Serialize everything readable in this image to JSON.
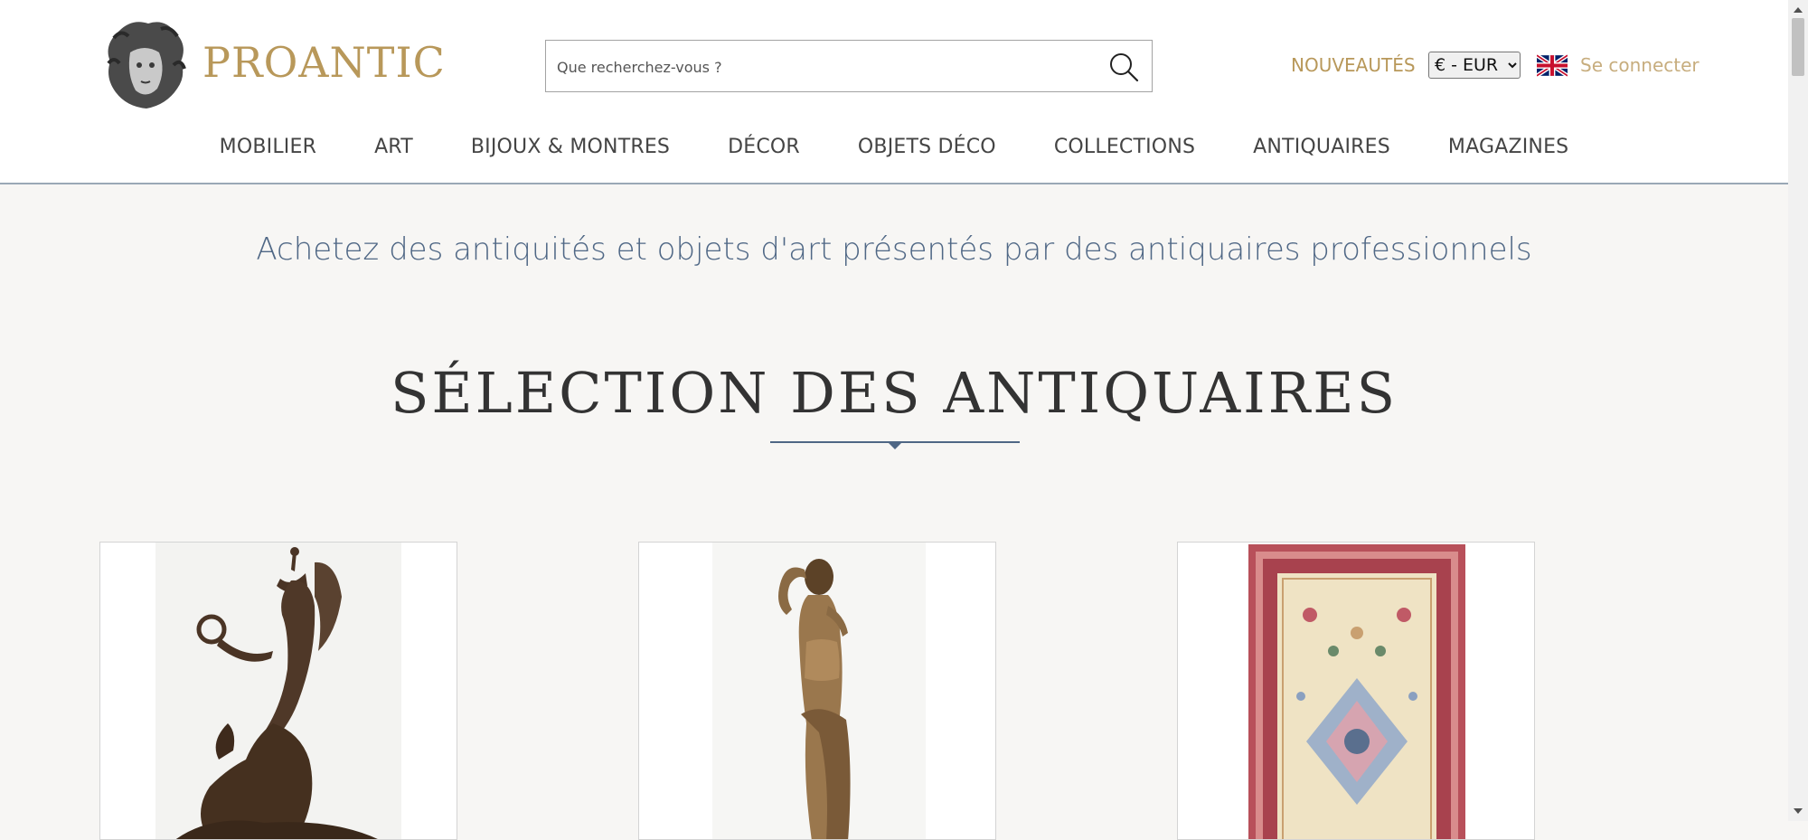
{
  "brand": {
    "name": "PROANTIC",
    "color": "#b8985a"
  },
  "search": {
    "placeholder": "Que recherchez-vous ?",
    "icon": "search-icon"
  },
  "header": {
    "nouveautes_label": "NOUVEAUTÉS",
    "currency": {
      "selected": "€ - EUR"
    },
    "flag_icon": "uk-flag-icon",
    "login_label": "Se connecter"
  },
  "nav": {
    "items": [
      {
        "label": "MOBILIER"
      },
      {
        "label": "ART"
      },
      {
        "label": "BIJOUX & MONTRES"
      },
      {
        "label": "DÉCOR"
      },
      {
        "label": "OBJETS DÉCO"
      },
      {
        "label": "COLLECTIONS"
      },
      {
        "label": "ANTIQUAIRES"
      },
      {
        "label": "MAGAZINES"
      }
    ]
  },
  "main": {
    "tagline": "Achetez des antiquités et objets d'art présentés par des antiquaires professionnels",
    "section_title": "SÉLECTION DES ANTIQUAIRES",
    "accent": "#4f6785"
  },
  "cards": [
    {
      "image": "bronze-winged-figure-sculpture"
    },
    {
      "image": "bronze-standing-nude-statue"
    },
    {
      "image": "persian-rug"
    }
  ]
}
